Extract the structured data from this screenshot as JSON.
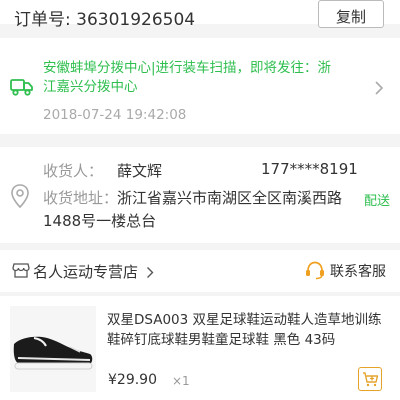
{
  "order": {
    "number_label": "订单号: 36301926504",
    "copy_label": "复制"
  },
  "logistics": {
    "status_text": "安徽蚌埠分拨中心|进行装车扫描，即将发往：浙江嘉兴分拨中心",
    "timestamp": "2018-07-24 19:42:08",
    "icon": "truck-icon",
    "color": "#2fbf4f"
  },
  "receiver": {
    "name_label": "收货人：",
    "name": "薛文辉",
    "phone": "177****8191",
    "address_label": "收货地址：",
    "address": "浙江省嘉兴市南湖区全区南溪西路1488号一楼总台",
    "delivery_tag": "配送",
    "icon": "location-pin-icon"
  },
  "store": {
    "name": "名人运动专营店",
    "service_label": "联系客服",
    "shop_icon": "shop-icon",
    "service_icon": "customer-service-icon",
    "service_color": "#f0a020"
  },
  "product": {
    "title": "双星DSA003 双星足球鞋运动鞋人造草地训练鞋碎钉底球鞋男鞋童足球鞋 黑色 43码",
    "price": "¥29.90",
    "quantity": "×1",
    "cart_icon": "add-to-cart-icon",
    "cart_color": "#e6a32b"
  }
}
